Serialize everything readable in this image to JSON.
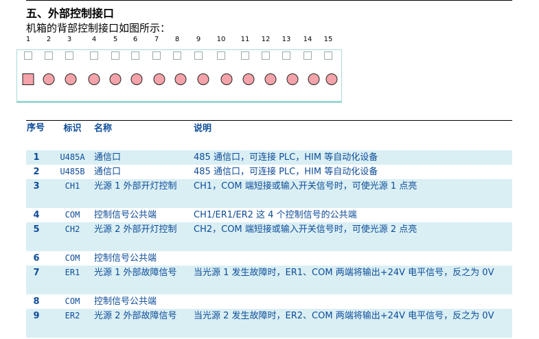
{
  "section": {
    "title": "五、外部控制接口",
    "intro": "机箱的背部控制接口如图所示："
  },
  "connector": {
    "pin_numbers": [
      "1",
      "2",
      "3",
      "4",
      "5",
      "6",
      "7",
      "8",
      "9",
      "10",
      "11",
      "12",
      "13",
      "14",
      "15"
    ],
    "hole_fill": "#f3a3a9",
    "panel_border": "#a8d9d8"
  },
  "table": {
    "headers": {
      "index": "序号",
      "code": "标识",
      "name": "名称",
      "desc": "说明"
    },
    "rows": [
      {
        "index": "1",
        "code": "U485A",
        "name": "通信口",
        "desc": "485 通信口，可连接 PLC，HIM 等自动化设备"
      },
      {
        "index": "2",
        "code": "U485B",
        "name": "通信口",
        "desc": "485 通信口，可连接 PLC，HIM 等自动化设备"
      },
      {
        "index": "3",
        "code": "CH1",
        "name": "光源 1 外部开灯控制",
        "desc": "CH1，COM 端短接或输入开关信号时，可使光源 1 点亮"
      },
      {
        "index": "4",
        "code": "COM",
        "name": "控制信号公共端",
        "desc": "CH1/ER1/ER2 这 4 个控制信号的公共端"
      },
      {
        "index": "5",
        "code": "CH2",
        "name": "光源 2 外部开灯控制",
        "desc": "CH2，COM 端短接或输入开关信号时，可使光源 2 点亮"
      },
      {
        "index": "6",
        "code": "COM",
        "name": "控制信号公共端",
        "desc": ""
      },
      {
        "index": "7",
        "code": "ER1",
        "name": "光源 1 外部故障信号",
        "desc": "当光源 1 发生故障时，ER1、COM 两端将输出+24V 电平信号，反之为 0V"
      },
      {
        "index": "8",
        "code": "COM",
        "name": "控制信号公共端",
        "desc": ""
      },
      {
        "index": "9",
        "code": "ER2",
        "name": "光源 2 外部故障信号",
        "desc": "当光源 2 发生故障时，ER2、COM 两端将输出+24V 电平信号，反之为 0V"
      }
    ]
  }
}
